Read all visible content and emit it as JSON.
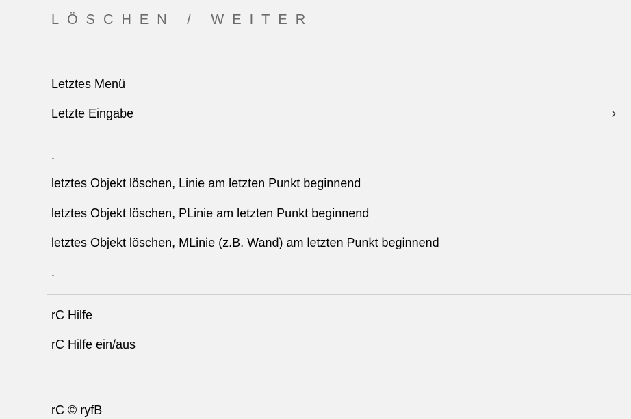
{
  "menu": {
    "title": "LÖSCHEN / WEITER",
    "items": [
      {
        "label": "Letztes Menü"
      },
      {
        "label": "Letzte Eingabe",
        "submenu_arrow": "›"
      },
      {
        "label": "."
      },
      {
        "label": "letztes Objekt löschen, Linie am letzten Punkt beginnend"
      },
      {
        "label": "letztes Objekt löschen, PLinie am letzten Punkt beginnend"
      },
      {
        "label": "letztes Objekt löschen, MLinie (z.B. Wand) am letzten Punkt beginnend"
      },
      {
        "label": "."
      },
      {
        "label": "rC Hilfe"
      },
      {
        "label": "rC Hilfe ein/aus"
      },
      {
        "label": "rC © ryfB"
      }
    ]
  },
  "colors": {
    "background": "#f2f2f2",
    "title": "#6b6b6b",
    "separator": "#cfcfcf",
    "text": "#000000"
  }
}
